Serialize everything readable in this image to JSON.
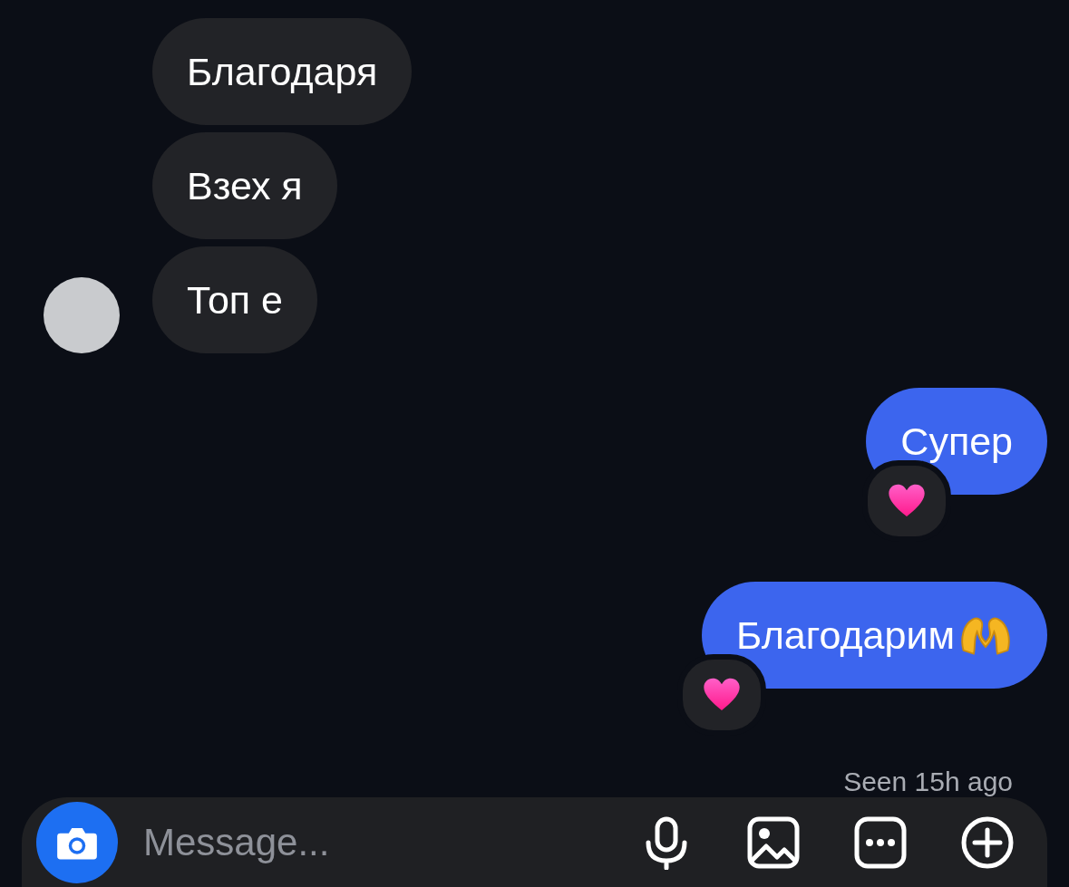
{
  "messages": [
    {
      "kind": "incoming",
      "text": "Благодаря",
      "reacted": false,
      "has_emoji": false
    },
    {
      "kind": "incoming",
      "text": "Взех я",
      "reacted": false,
      "has_emoji": false
    },
    {
      "kind": "incoming",
      "text": "Топ е",
      "reacted": false,
      "has_emoji": false
    },
    {
      "kind": "outgoing",
      "text": "Супер",
      "reacted": true,
      "has_emoji": false
    },
    {
      "kind": "outgoing",
      "text": "Благодарим",
      "reacted": true,
      "has_emoji": true
    }
  ],
  "seen_status": "Seen 15h ago",
  "composer": {
    "placeholder": "Message..."
  }
}
